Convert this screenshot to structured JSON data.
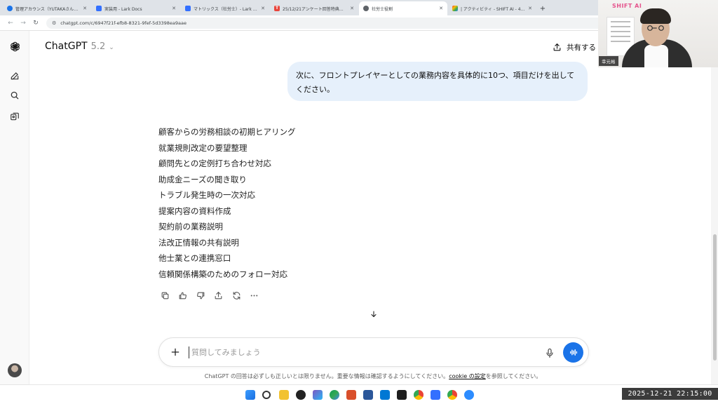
{
  "browser": {
    "tabs": [
      {
        "title": "管理アカウンス（YUTAKAさん）...",
        "icon": "chrome-icon",
        "color": "#1a73e8",
        "active": false
      },
      {
        "title": "実装用 - Lark Docs",
        "icon": "lark-docs-icon",
        "color": "#3370ff",
        "active": false
      },
      {
        "title": "マトリックス（社労士）- Lark Do...",
        "icon": "lark-docs-icon",
        "color": "#3370ff",
        "active": false
      },
      {
        "title": "25/12/21アンケート回答特典プロ...",
        "icon": "t-icon",
        "color": "#e8453c",
        "active": false
      },
      {
        "title": "社労士役割",
        "icon": "chatgpt-icon",
        "color": "#5f6368",
        "active": true
      },
      {
        "title": "| アクティビティ - SHIFT AI - 44 件...",
        "icon": "colorful-app-icon",
        "color": "#e37400",
        "active": false
      }
    ],
    "url": "chatgpt.com/c/6947f21f-efb8-8321-9fef-5d3398ea9aae"
  },
  "header": {
    "model_name": "ChatGPT",
    "model_version": "5.2",
    "share_label": "共有する"
  },
  "conversation": {
    "user_message": "次に、フロントプレイヤーとしての業務内容を具体的に10つ、項目だけを出してください。",
    "assistant_items": [
      "顧客からの労務相談の初期ヒアリング",
      "就業規則改定の要望整理",
      "顧問先との定例打ち合わせ対応",
      "助成金ニーズの聞き取り",
      "トラブル発生時の一次対応",
      "提案内容の資料作成",
      "契約前の業務説明",
      "法改正情報の共有説明",
      "他士業との連携窓口",
      "信頼関係構築のためのフォロー対応"
    ]
  },
  "composer": {
    "placeholder": "質問してみましょう"
  },
  "disclaimer": {
    "before": "ChatGPT の回答は必ずしも正しいとは限りません。重要な情報は確認するようにしてください。",
    "link": "cookie の設定",
    "after": "を参照してください。"
  },
  "webcam": {
    "logo": "SHIFT AI",
    "name": "幸元裕"
  },
  "taskbar": {
    "clock": "2025-12-21  22:15:00"
  },
  "colors": {
    "accent": "#1a73e8",
    "bubble": "#e6f0fb"
  }
}
